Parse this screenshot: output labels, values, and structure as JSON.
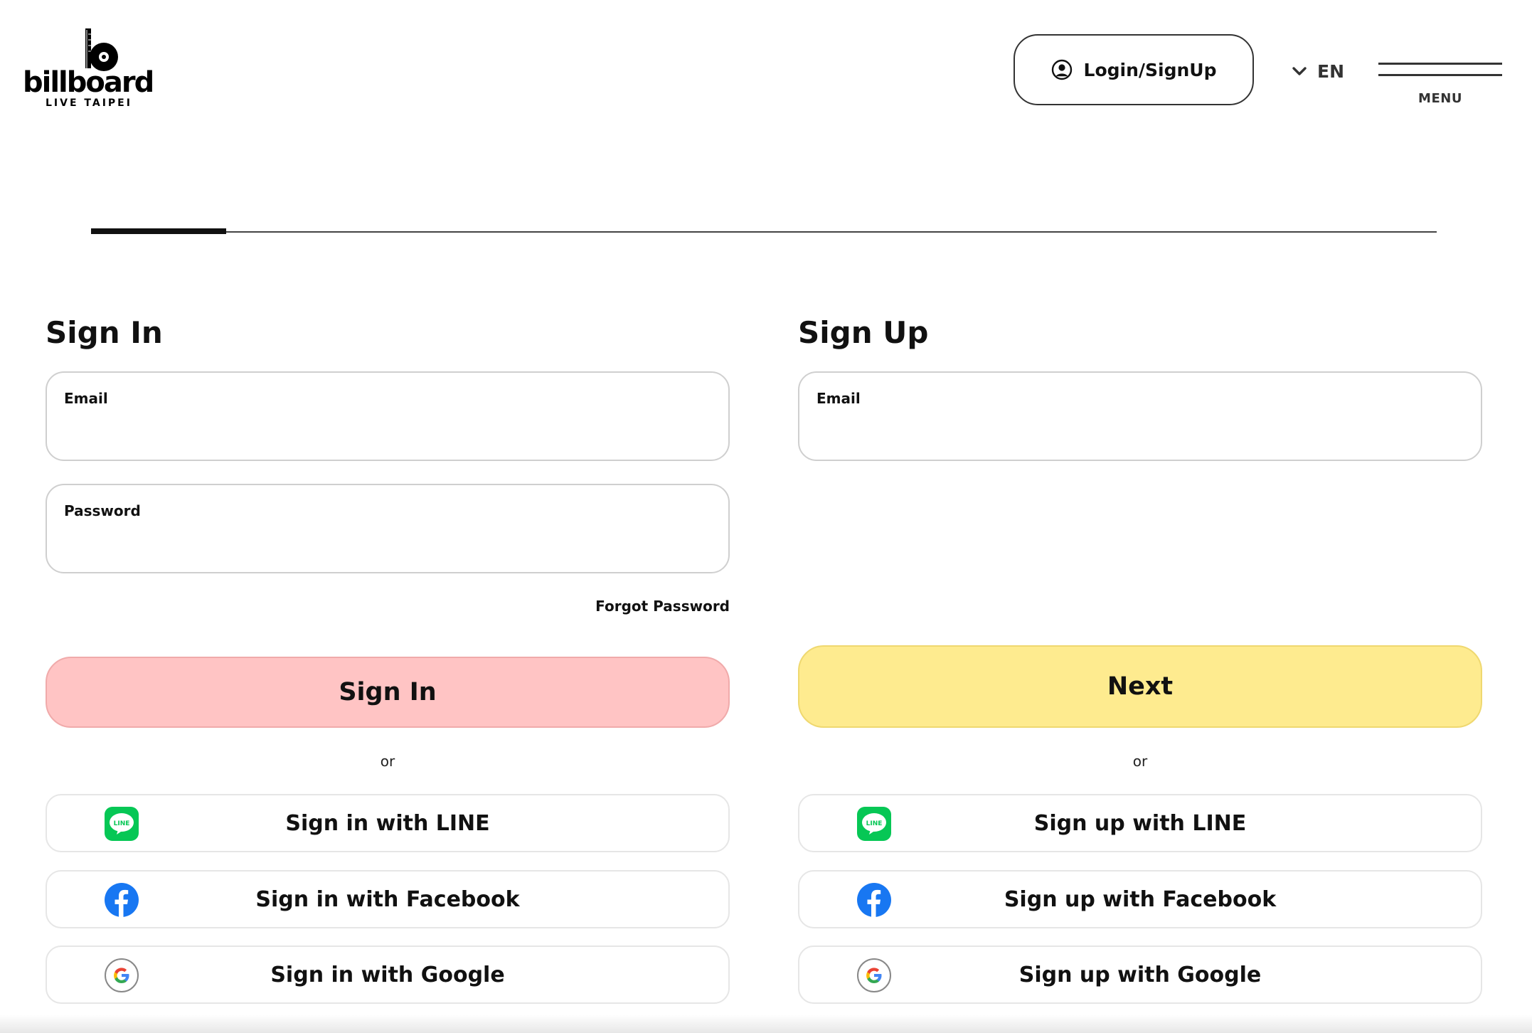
{
  "header": {
    "logo_text": "billboard",
    "logo_sub": "LIVE TAIPEI",
    "login_label": "Login/SignUp",
    "language": "EN",
    "menu_label": "MENU"
  },
  "progress": {
    "step": 1,
    "fraction": 0.1
  },
  "signin": {
    "title": "Sign In",
    "email_label": "Email",
    "email_value": "",
    "password_label": "Password",
    "password_value": "",
    "forgot_label": "Forgot Password",
    "submit_label": "Sign In",
    "or_label": "or",
    "line_label": "Sign in with LINE",
    "facebook_label": "Sign in with Facebook",
    "google_label": "Sign in with Google"
  },
  "signup": {
    "title": "Sign Up",
    "email_label": "Email",
    "email_value": "",
    "submit_label": "Next",
    "or_label": "or",
    "line_label": "Sign up with LINE",
    "facebook_label": "Sign up with Facebook",
    "google_label": "Sign up with Google"
  },
  "icons": {
    "user": "user-circle-icon",
    "language": "chevron-down-icon",
    "line": "line-icon",
    "facebook": "facebook-icon",
    "google": "google-icon"
  },
  "colors": {
    "signin_button": "#ffc4c4",
    "next_button": "#feeb8f",
    "line_green": "#06c755",
    "facebook_blue": "#1877f2"
  }
}
